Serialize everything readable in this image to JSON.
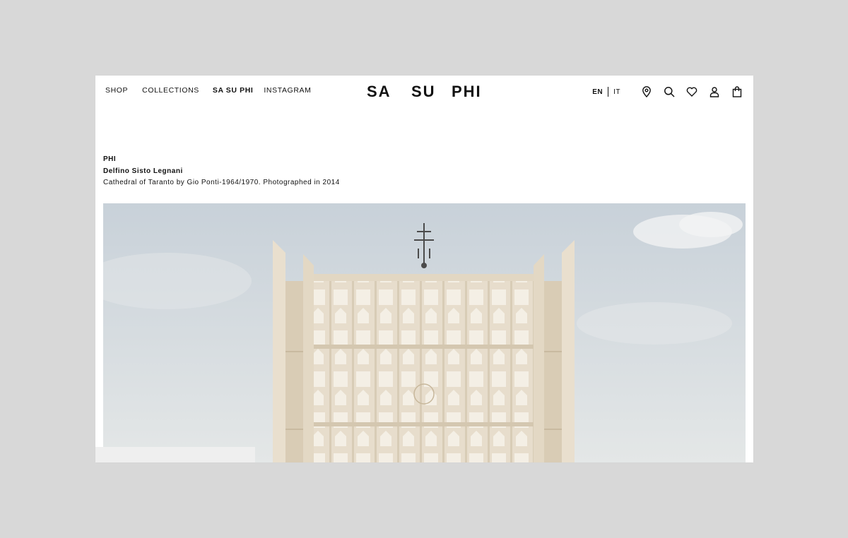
{
  "header": {
    "nav": {
      "shop": "SHOP",
      "collections": "COLLECTIONS",
      "sasuphi": "SA SU PHI",
      "instagram": "INSTAGRAM"
    },
    "logo": {
      "part1": "SA",
      "part2": "SU",
      "part3": "PHI"
    },
    "lang": {
      "en": "EN",
      "it": "IT"
    },
    "icons": [
      "location-pin-icon",
      "search-icon",
      "heart-icon",
      "user-icon",
      "shopping-bag-icon"
    ]
  },
  "caption": {
    "title": "PHI",
    "author": "Delfino Sisto Legnani",
    "description": "Cathedral of Taranto by Gio Ponti-1964/1970. Photographed in 2014"
  },
  "colors": {
    "background": "#d8d8d8",
    "page": "#ffffff",
    "text": "#111111",
    "sky": "#d3dae0",
    "concrete": "#e6dccb"
  }
}
